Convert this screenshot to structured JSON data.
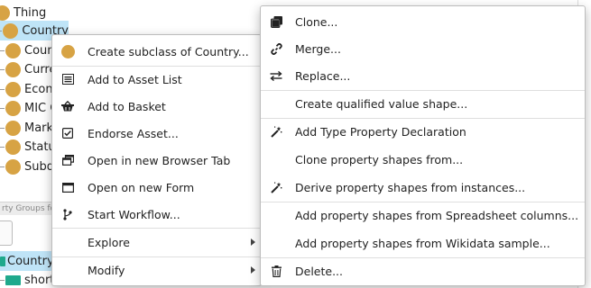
{
  "tree": {
    "root_label": "Thing",
    "rows": [
      {
        "label": "Country",
        "selected": true
      },
      {
        "label": "Coun"
      },
      {
        "label": "Curre"
      },
      {
        "label": "Econo"
      },
      {
        "label": "MIC C"
      },
      {
        "label": "Mark"
      },
      {
        "label": "Statu"
      },
      {
        "label": "Subd"
      }
    ]
  },
  "property_panel": {
    "header": "rty Groups fo",
    "rows": [
      {
        "label": "Country",
        "color": "#1fa98c"
      },
      {
        "label": "short",
        "color": "#1fa98c"
      }
    ]
  },
  "context_menu": {
    "items": [
      {
        "label": "Create subclass of Country...",
        "icon": "class-circle-icon"
      },
      {
        "label": "Add to Asset List",
        "icon": "list-icon"
      },
      {
        "label": "Add to Basket",
        "icon": "basket-icon"
      },
      {
        "label": "Endorse Asset...",
        "icon": "checkbox-icon"
      },
      {
        "label": "Open in new Browser Tab",
        "icon": "new-tab-icon"
      },
      {
        "label": "Open on new Form",
        "icon": "form-icon"
      },
      {
        "label": "Start Workflow...",
        "icon": "workflow-icon"
      },
      {
        "label": "Explore",
        "submenu": true
      },
      {
        "label": "Modify",
        "submenu": true
      }
    ]
  },
  "modify_submenu": {
    "items": [
      {
        "label": "Clone...",
        "icon": "clone-icon"
      },
      {
        "label": "Merge...",
        "icon": "link-icon"
      },
      {
        "label": "Replace...",
        "icon": "swap-icon"
      },
      {
        "label": "Create qualified value shape...",
        "icon": ""
      },
      {
        "label": "Add Type Property Declaration",
        "icon": "magic-wand-icon"
      },
      {
        "label": "Clone property shapes from...",
        "icon": ""
      },
      {
        "label": "Derive property shapes from instances...",
        "icon": "magic-wand-icon"
      },
      {
        "label": "Add property shapes from Spreadsheet columns...",
        "icon": ""
      },
      {
        "label": "Add property shapes from Wikidata sample...",
        "icon": ""
      },
      {
        "label": "Delete...",
        "icon": "trash-icon"
      }
    ]
  },
  "colors": {
    "class_dot": "#d7a344",
    "selection": "#bfe4f7",
    "property_type": "#1fa98c"
  }
}
